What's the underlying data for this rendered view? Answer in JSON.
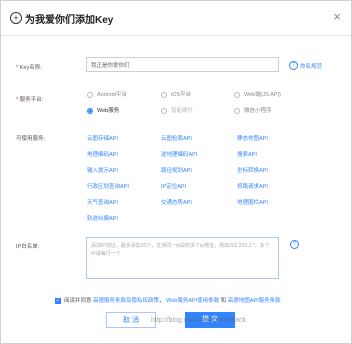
{
  "dialog": {
    "icon": "plus-circle-icon",
    "title": "为我爱你们添加Key",
    "close_icon": "close-icon"
  },
  "form": {
    "key_name_label": "Key名称:",
    "key_name_value": "我正是你爱你们",
    "naming_rule_link": "命名规范",
    "platform_label": "服务平台:",
    "platforms": [
      {
        "label": "Android平台",
        "checked": false,
        "disabled": false
      },
      {
        "label": "iOS平台",
        "checked": false,
        "disabled": false
      },
      {
        "label": "Web端(JS API)",
        "checked": false,
        "disabled": false
      },
      {
        "label": "Web服务",
        "checked": true,
        "disabled": false
      },
      {
        "label": "智能硬件",
        "checked": false,
        "disabled": true
      },
      {
        "label": "微信小程序",
        "checked": false,
        "disabled": false
      }
    ],
    "services_label": "可使用服务:",
    "services": [
      "云图存储API",
      "云图检索API",
      "静态地图API",
      "地理编码API",
      "逆地理编码API",
      "搜索API",
      "输入提示API",
      "路径规划API",
      "坐标转换API",
      "行政区划查询API",
      "IP定位API",
      "抓路请求API",
      "天气查询API",
      "交通态势API",
      "地理围栏API",
      "轨迹纠偏API"
    ],
    "whitelist_label": "IP白名单:",
    "whitelist_placeholder": "添加IP地址，最多添加10个，支持同一ip段的多个ip地址，例如202.202.2.*，多个IP请每行一个",
    "agree_prefix": "阅读并同意",
    "agree_link1": "高德服务条款及隐私权政策",
    "agree_sep1": "，",
    "agree_link2": "Web服务API使用条款",
    "agree_sep2": "和",
    "agree_link3": "高德地图API服务条款",
    "cancel_label": "取 消",
    "ok_label": "提 交"
  },
  "watermark": "http://blog.csdn.net/coderblack"
}
